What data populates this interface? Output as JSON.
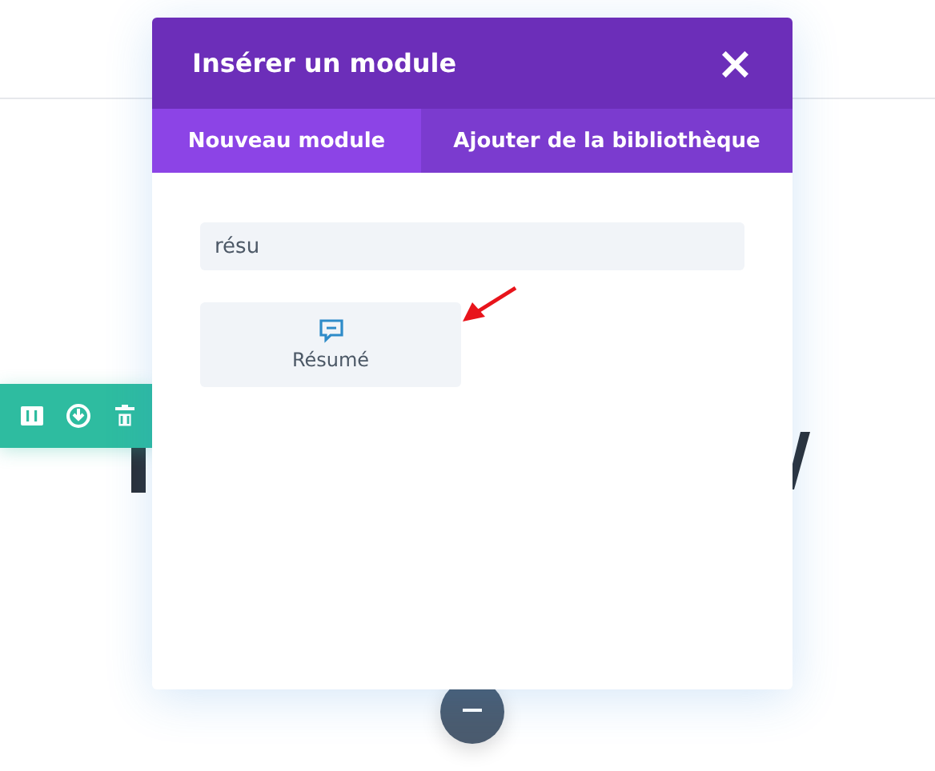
{
  "modal": {
    "title": "Insérer un module",
    "close": "×"
  },
  "tabs": [
    {
      "label": "Nouveau module",
      "selected": true
    },
    {
      "label": "Ajouter de la bibliothèque",
      "selected": false
    }
  ],
  "search": {
    "value": "résu"
  },
  "modules": [
    {
      "label": "Résumé"
    }
  ],
  "row_toolbar": {
    "items": [
      {
        "kind": "columns"
      },
      {
        "kind": "save"
      },
      {
        "kind": "delete"
      }
    ]
  }
}
